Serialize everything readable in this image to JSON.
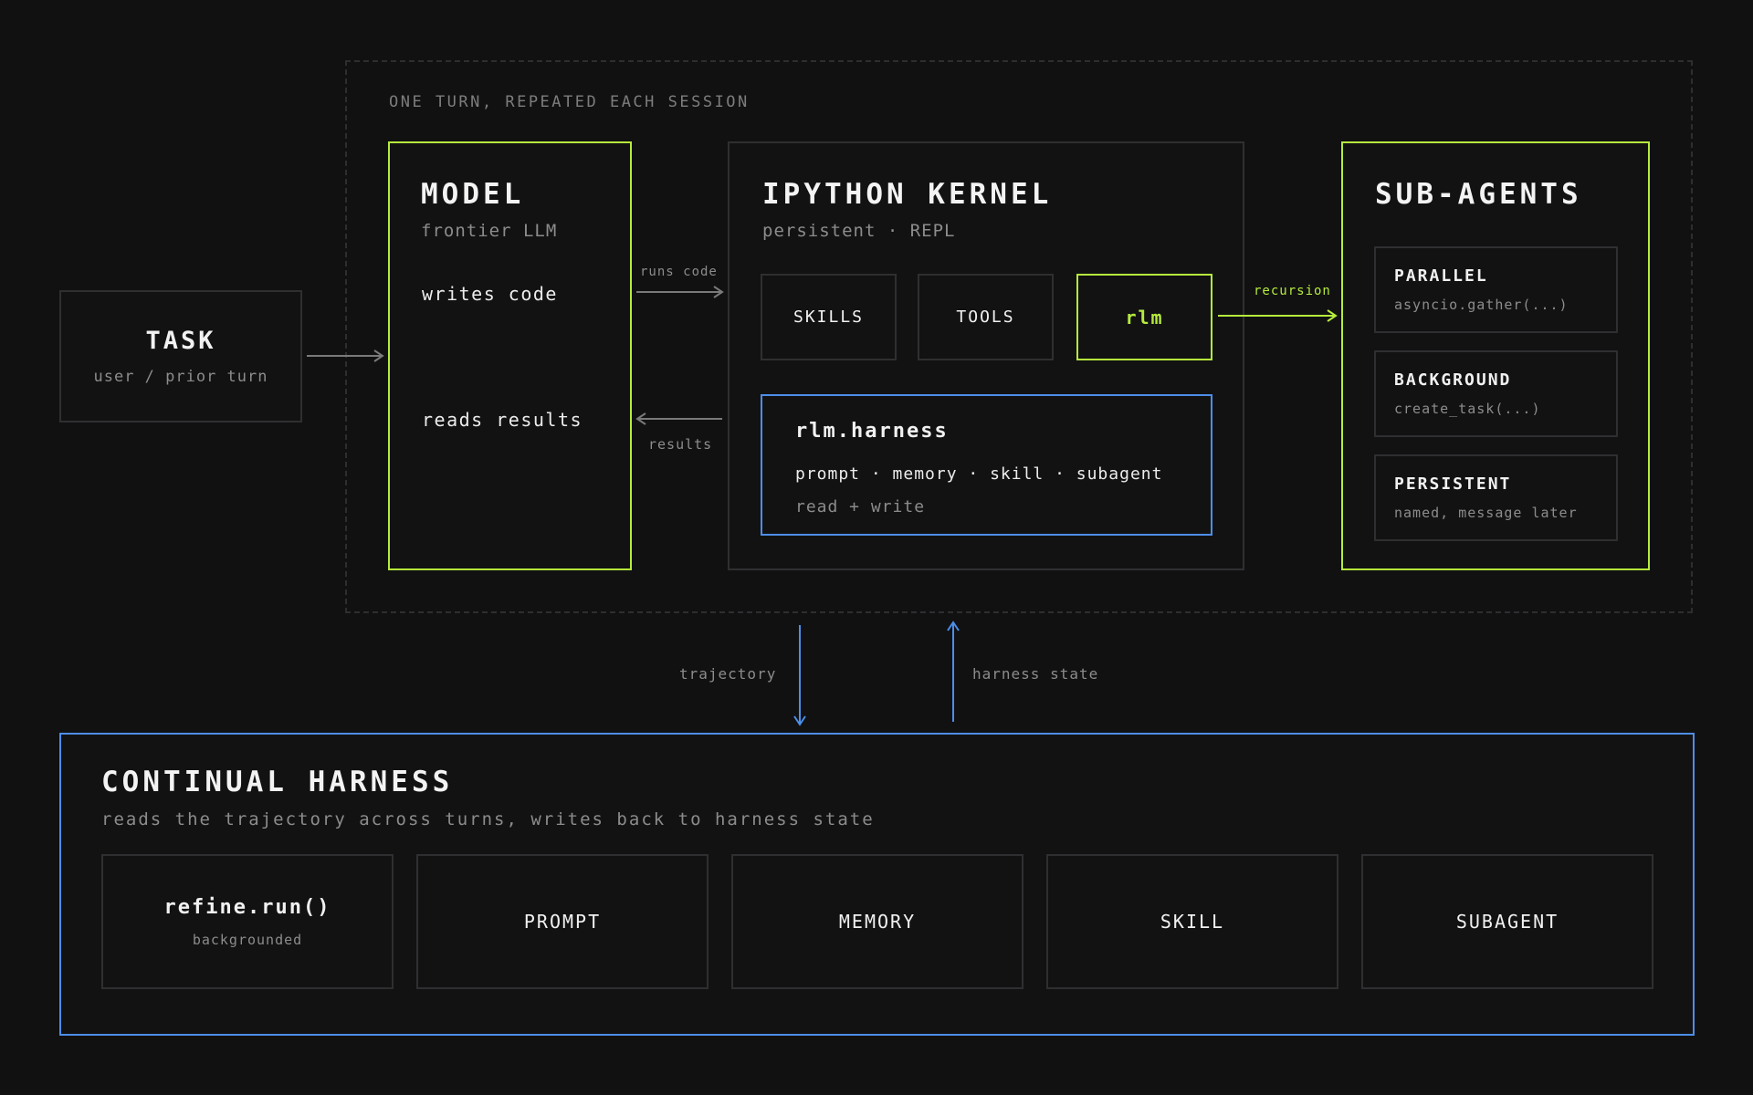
{
  "frame": {
    "label": "ONE TURN, REPEATED EACH SESSION"
  },
  "task": {
    "title": "TASK",
    "subtitle": "user / prior turn"
  },
  "model": {
    "title": "MODEL",
    "subtitle": "frontier LLM",
    "writes": "writes code",
    "reads": "reads results"
  },
  "edges": {
    "runs_code": "runs code",
    "results": "results",
    "recursion": "recursion",
    "trajectory": "trajectory",
    "harness_state": "harness state"
  },
  "kernel": {
    "title": "IPYTHON KERNEL",
    "subtitle": "persistent · REPL",
    "chips": [
      "SKILLS",
      "TOOLS",
      "rlm"
    ],
    "harness": {
      "title": "rlm.harness",
      "items": "prompt · memory · skill · subagent",
      "note": "read + write"
    }
  },
  "subagents": {
    "title": "SUB-AGENTS",
    "items": [
      {
        "name": "PARALLEL",
        "desc": "asyncio.gather(...)"
      },
      {
        "name": "BACKGROUND",
        "desc": "create_task(...)"
      },
      {
        "name": "PERSISTENT",
        "desc": "named, message later"
      }
    ]
  },
  "continual": {
    "title": "CONTINUAL HARNESS",
    "subtitle": "reads the trajectory across turns, writes back to harness state",
    "cards": [
      {
        "title": "refine.run()",
        "sub": "backgrounded"
      },
      {
        "title": "PROMPT",
        "sub": ""
      },
      {
        "title": "MEMORY",
        "sub": ""
      },
      {
        "title": "SKILL",
        "sub": ""
      },
      {
        "title": "SUBAGENT",
        "sub": ""
      }
    ]
  },
  "colors": {
    "green": "#b6ec3c",
    "blue": "#4d8ee8",
    "border": "#2f2f31",
    "background": "#111112"
  }
}
